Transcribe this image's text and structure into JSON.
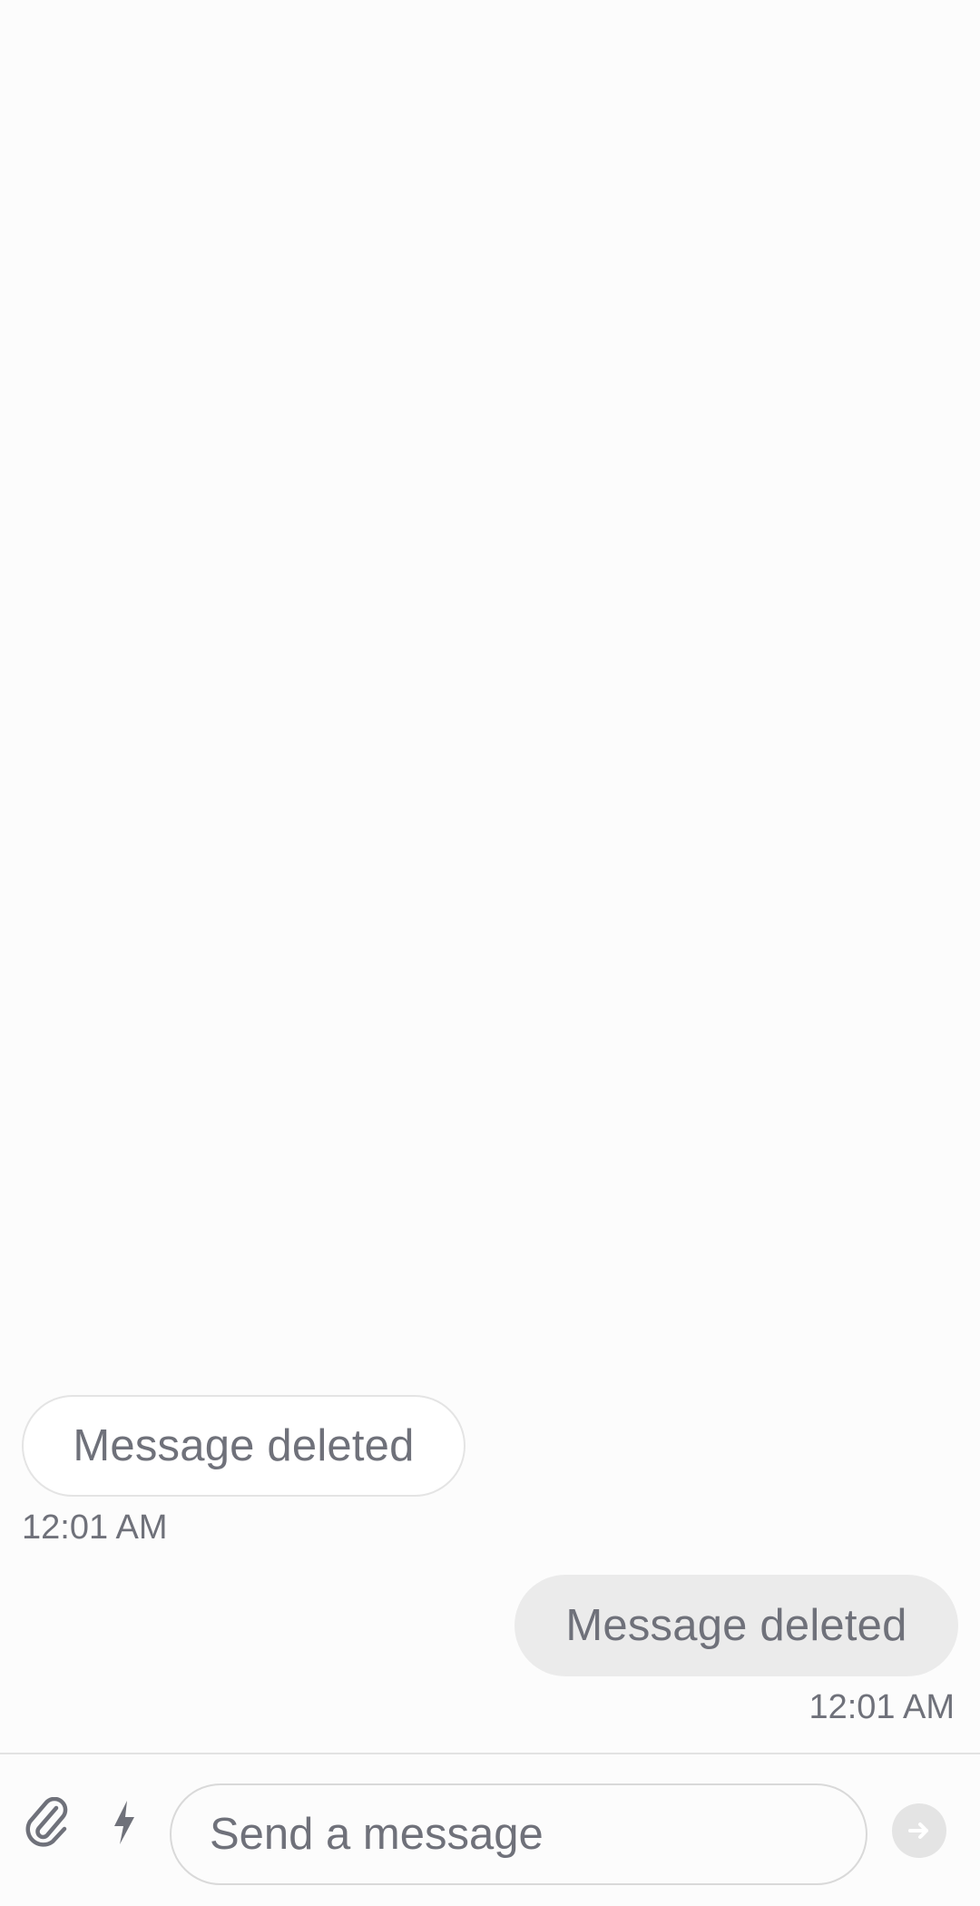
{
  "messages": [
    {
      "direction": "incoming",
      "text": "Message deleted",
      "time": "12:01 AM"
    },
    {
      "direction": "outgoing",
      "text": "Message deleted",
      "time": "12:01 AM"
    }
  ],
  "composer": {
    "placeholder": "Send a message",
    "attach_icon": "paperclip-icon",
    "quick_reply_icon": "lightning-bolt-icon",
    "send_icon": "arrow-right-icon"
  },
  "colors": {
    "background": "#fcfcfc",
    "incoming_bubble": "#ffffff",
    "outgoing_bubble": "#ebebeb",
    "muted_text": "#6f717a",
    "send_button": "#e4e4e4"
  }
}
